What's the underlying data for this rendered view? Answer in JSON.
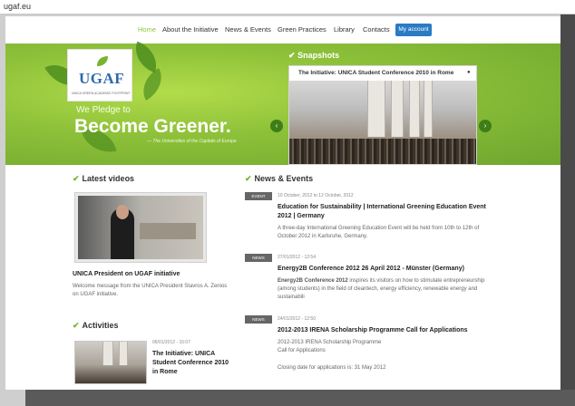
{
  "browser": {
    "url": "ugaf.eu"
  },
  "nav": {
    "items": [
      "Home",
      "About the Initiative",
      "News & Events",
      "Green Practices",
      "Library",
      "Contacts"
    ],
    "account_button": "My account"
  },
  "logo": {
    "text": "UGAF",
    "subtitle": "UNICA GREEN ACADEMIC FOOTPRINT"
  },
  "hero": {
    "pledge": "We Pledge to",
    "headline": "Become Greener.",
    "subline": "— The Universities of the Capitals of Europe"
  },
  "snapshots": {
    "heading": "Snapshots",
    "caption": "The Initiative: UNICA Student Conference 2010 in Rome",
    "caption_icon": "chevron-right-circle-icon",
    "prev_icon": "chevron-left-icon",
    "next_icon": "chevron-right-icon"
  },
  "latest_videos": {
    "heading": "Latest videos",
    "video_title": "UNICA President on UGAF initiative",
    "video_desc": "Welcome message from the UNICA President Stavros A. Zenios on UGAF initiative."
  },
  "activities": {
    "heading": "Activities",
    "date": "06/01/2012 - 15:07",
    "title": "The Initiative: UNICA Student Conference 2010 in Rome"
  },
  "news": {
    "heading": "News & Events",
    "items": [
      {
        "tag": "EVENT",
        "date": "10 October, 2012 to 12 October, 2012",
        "title": "Education for Sustainability | International Greening Education Event 2012 | Germany",
        "desc": "A three-day International Greening Education Event will be held from 10th to 12th of October 2012 in Karlsruhe, Germany."
      },
      {
        "tag": "NEWS",
        "date": "27/01/2012 - 12:54",
        "title": "Energy2B Conference 2012 26 April 2012 - Münster (Germany)",
        "desc_bold": "Energy2B Conference 2012",
        "desc": " inspires its visitors on how to stimulate entrepreneurship (among students) in the field of cleantech, energy efficiency, renewable energy and sustainabili"
      },
      {
        "tag": "NEWS",
        "date": "24/01/2012 - 12:50",
        "title": "2012-2013 IRENA Scholarship Programme Call for Applications",
        "desc_line1": "2012-2013 IRENA Scholarship Programme",
        "desc_line2": "Call for Applications",
        "desc_line3": "Closing date for applications is: 31 May 2012"
      }
    ]
  },
  "colors": {
    "accent_green": "#8dc63f",
    "button_blue": "#2a7bc4"
  }
}
